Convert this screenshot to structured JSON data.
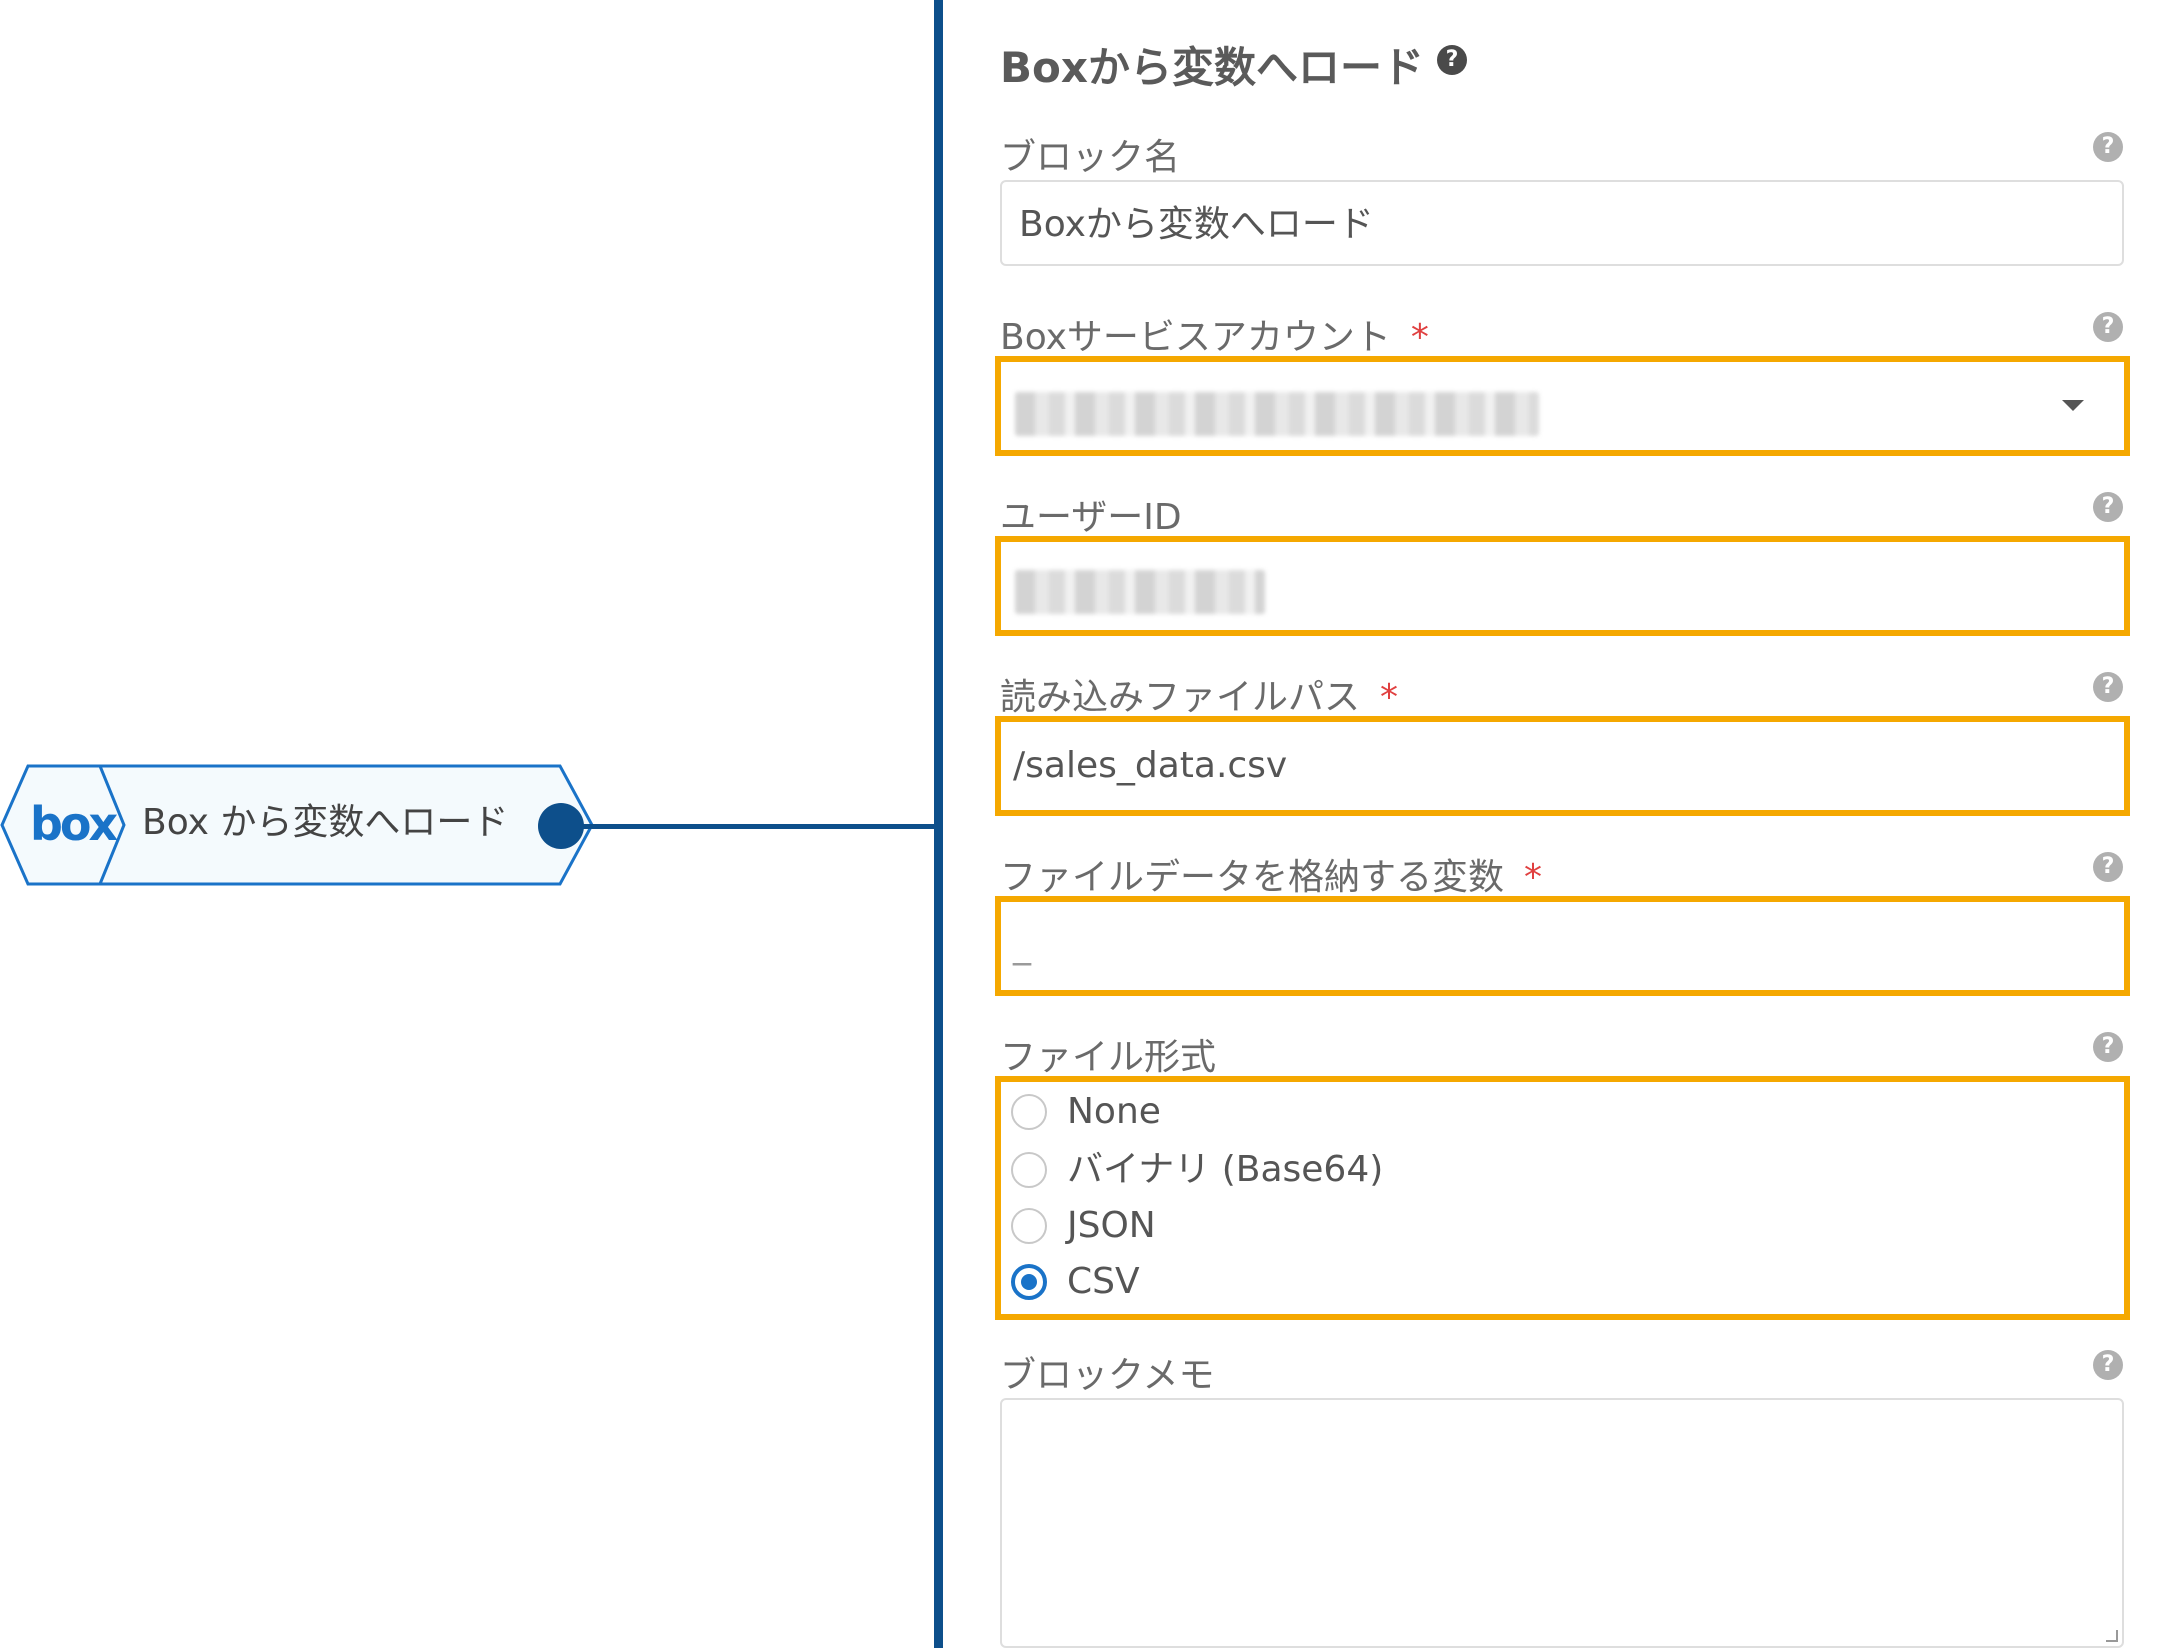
{
  "canvas": {
    "block_node": {
      "logo_text": "box",
      "label": "Box から変数へロード"
    }
  },
  "panel": {
    "title": "Boxから変数へロード",
    "help_glyph": "?",
    "required_mark": "*",
    "fields": {
      "block_name": {
        "label": "ブロック名",
        "value": "Boxから変数へロード"
      },
      "service_account": {
        "label": "Boxサービスアカウント",
        "required": true,
        "value_obscured": true
      },
      "user_id": {
        "label": "ユーザーID",
        "value_obscured": true
      },
      "file_path": {
        "label": "読み込みファイルパス",
        "required": true,
        "value": "/sales_data.csv"
      },
      "data_variable": {
        "label": "ファイルデータを格納する変数",
        "required": true,
        "value": "_"
      },
      "file_format": {
        "label": "ファイル形式",
        "options": [
          "None",
          "バイナリ (Base64)",
          "JSON",
          "CSV"
        ],
        "selected": "CSV"
      },
      "block_memo": {
        "label": "ブロックメモ",
        "value": ""
      }
    }
  },
  "colors": {
    "accent_blue": "#0d4f8b",
    "radio_blue": "#1a73c8",
    "highlight_orange": "#f5a800",
    "required_red": "#e04040"
  }
}
